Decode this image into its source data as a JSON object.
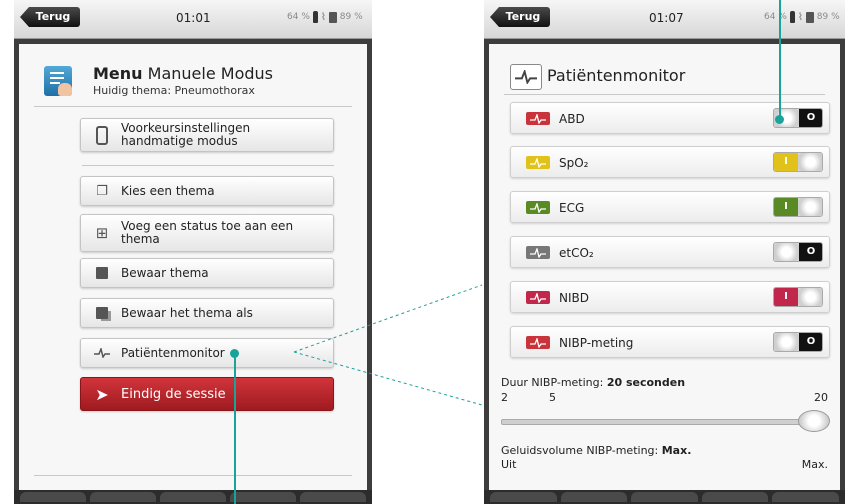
{
  "left_screen": {
    "back_label": "Terug",
    "time": "01:01",
    "signal_text": "64 %",
    "battery_text": "89 %",
    "menu_title_bold": "Menu",
    "menu_title_rest": " Manuele Modus",
    "menu_subtitle": "Huidig thema: Pneumothorax",
    "buttons": {
      "preferences": {
        "line1": "Voorkeursinstellingen",
        "line2": "handmatige modus"
      },
      "choose_theme": "Kies een thema",
      "add_status": {
        "line1": "Voeg een status toe aan een",
        "line2": "thema"
      },
      "save_theme": "Bewaar thema",
      "save_theme_as": "Bewaar het thema als",
      "patient_monitor": "Patiëntenmonitor",
      "end_session": "Eindig de sessie"
    }
  },
  "right_screen": {
    "back_label": "Terug",
    "time": "01:07",
    "signal_text": "64 %",
    "battery_text": "89 %",
    "title": "Patiëntenmonitor",
    "rows": [
      {
        "label": "ABD",
        "state": "O",
        "on": false,
        "color": "#c9343b"
      },
      {
        "label": "SpO₂",
        "state": "I",
        "on": true,
        "color": "#e0c21a"
      },
      {
        "label": "ECG",
        "state": "I",
        "on": true,
        "color": "#5a8a23"
      },
      {
        "label": "etCO₂",
        "state": "O",
        "on": false,
        "color": "#777777"
      },
      {
        "label": "NIBD",
        "state": "I",
        "on": true,
        "color": "#c1274a"
      },
      {
        "label": "NIBP-meting",
        "state": "O",
        "on": false,
        "color": "#c9343b"
      }
    ],
    "duration_label": "Duur NIBP-meting: ",
    "duration_value": "20 seconden",
    "slider_ticks": {
      "min": "2",
      "mid": "5",
      "max": "20"
    },
    "slider_value": 20,
    "volume_label": "Geluidsvolume NIBP-meting: ",
    "volume_value": "Max.",
    "volume_min": "Uit",
    "volume_max": "Max."
  },
  "colors": {
    "callout": "#1aa39a",
    "end_session": "#b52025"
  }
}
